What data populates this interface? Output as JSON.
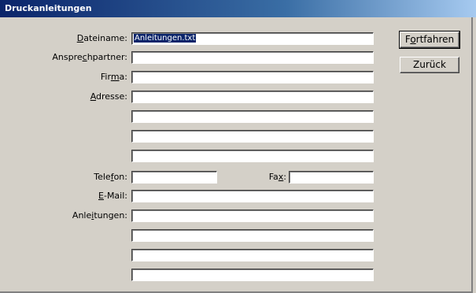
{
  "window": {
    "title": "Druckanleitungen"
  },
  "labels": {
    "dateiname": [
      "",
      "D",
      "ateiname:"
    ],
    "ansprechpartner": [
      "Anspre",
      "c",
      "hpartner:"
    ],
    "firma": [
      "Fir",
      "m",
      "a:"
    ],
    "adresse": [
      "",
      "A",
      "dresse:"
    ],
    "telefon": [
      "Tele",
      "f",
      "on:"
    ],
    "fax": [
      "Fa",
      "x",
      ":"
    ],
    "email": [
      "",
      "E",
      "-Mail:"
    ],
    "anleitungen": [
      "Anle",
      "i",
      "tungen:"
    ]
  },
  "fields": {
    "dateiname": "Anleitungen.txt",
    "ansprechpartner": "",
    "firma": "",
    "adresse": [
      "",
      "",
      "",
      ""
    ],
    "telefon": "",
    "fax": "",
    "email": "",
    "anleitungen": [
      "",
      "",
      "",
      ""
    ]
  },
  "buttons": {
    "fortfahren": [
      "F",
      "o",
      "rtfahren"
    ],
    "zurueck": "Zurück"
  }
}
